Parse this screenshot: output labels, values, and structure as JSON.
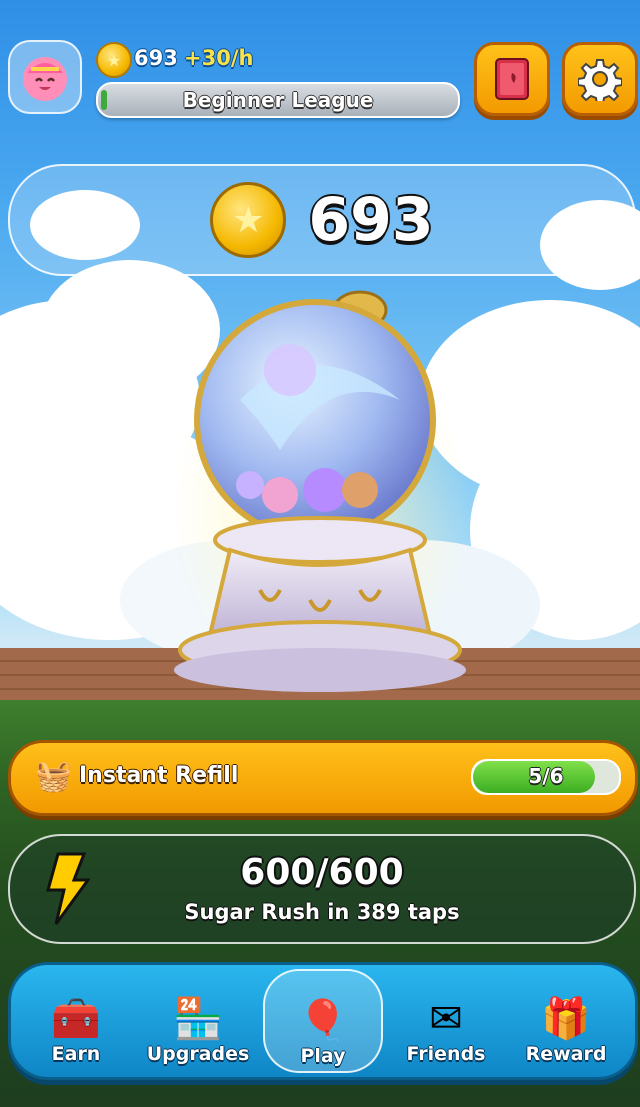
{
  "header": {
    "coins": "693",
    "rate": "+30/h",
    "league": "Beginner League",
    "league_progress": 0.02
  },
  "counter": {
    "value": "693"
  },
  "refill": {
    "label": "Instant Refill",
    "progress_text": "5/6",
    "progress": 0.8333
  },
  "energy": {
    "value": "600/600",
    "subtitle": "Sugar Rush in 389 taps"
  },
  "nav": {
    "items": [
      {
        "label": "Earn",
        "icon": "treasure-chest-icon"
      },
      {
        "label": "Upgrades",
        "icon": "shop-icon"
      },
      {
        "label": "Play",
        "icon": "balloons-icon"
      },
      {
        "label": "Friends",
        "icon": "envelope-icon"
      },
      {
        "label": "Reward",
        "icon": "gift-icon"
      }
    ],
    "active": "Play"
  },
  "colors": {
    "accent_orange": "#f5a300",
    "nav_blue": "#1aa0de",
    "coin_gold": "#f5b800",
    "progress_green": "#3cad22"
  }
}
